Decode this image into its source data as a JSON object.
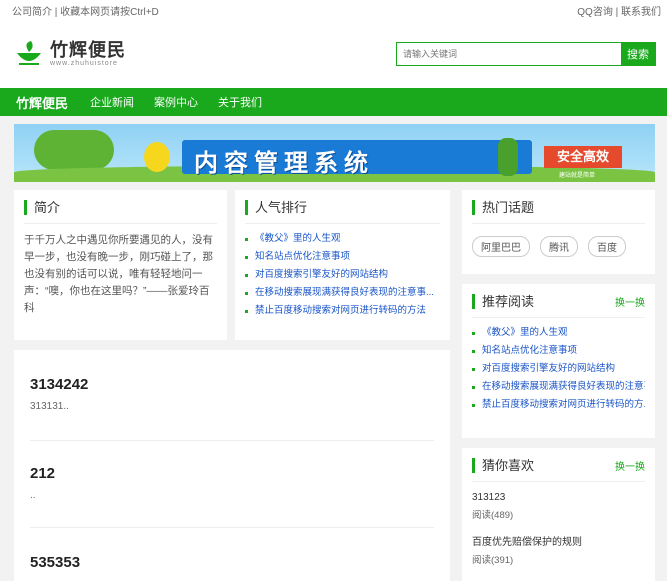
{
  "topbar": {
    "left": "公司简介 | 收藏本网页请按Ctrl+D",
    "right": "QQ咨询 | 联系我们"
  },
  "header": {
    "logo_name": "竹辉便民",
    "logo_sub": "www.zhuhuistore",
    "search_placeholder": "请输入关键词",
    "search_button": "搜索"
  },
  "nav": {
    "brand": "竹辉便民",
    "items": [
      "企业新闻",
      "案例中心",
      "关于我们"
    ]
  },
  "banner": {
    "title": "内容管理系统",
    "badge": "安全高效",
    "hint": "建站就是简单"
  },
  "intro": {
    "title": "简介",
    "text": "于千万人之中遇见你所要遇见的人，没有早一步，也没有晚一步，刚巧碰上了，那也没有别的话可以说，唯有轻轻地问一声：“噢，你也在这里吗？”——张爱玲百科"
  },
  "popular": {
    "title": "人气排行",
    "items": [
      "《教父》里的人生观",
      "知名站点优化注意事项",
      "对百度搜索引擎友好的网站结构",
      "在移动搜索展现满获得良好表现的注意事...",
      "禁止百度移动搜索对网页进行转码的方法"
    ]
  },
  "hot_topics": {
    "title": "热门话题",
    "tags": [
      "阿里巴巴",
      "腾讯",
      "百度"
    ]
  },
  "recommend": {
    "title": "推荐阅读",
    "more": "换一换",
    "items": [
      "《教父》里的人生观",
      "知名站点优化注意事项",
      "对百度搜索引擎友好的网站结构",
      "在移动搜索展现满获得良好表现的注意事...",
      "禁止百度移动搜索对网页进行转码的方..."
    ]
  },
  "posts": [
    {
      "title": "3134242",
      "desc": "313131.."
    },
    {
      "title": "212",
      "desc": ".."
    },
    {
      "title": "535353",
      "desc": ""
    }
  ],
  "guess": {
    "title": "猜你喜欢",
    "more": "换一换",
    "items": [
      {
        "title": "313123",
        "reads": "阅读(489)"
      },
      {
        "title": "百度优先赔偿保护的规则",
        "reads": "阅读(391)"
      }
    ]
  },
  "colors": {
    "accent": "#1aa91c",
    "link": "#1a55c8"
  }
}
